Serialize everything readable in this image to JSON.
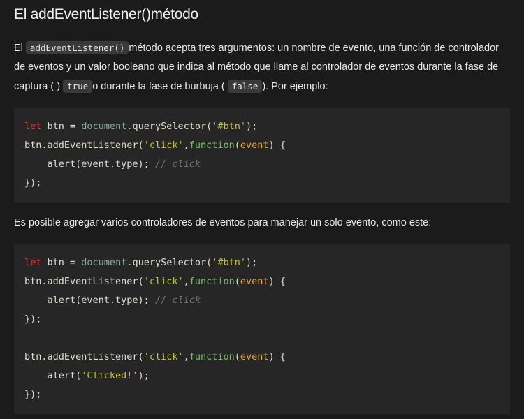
{
  "title": "El addEventListener()método",
  "para1": {
    "t1": "El ",
    "code1": "addEventListener()",
    "t2": "método acepta tres argumentos: un nombre de evento, una función de controlador de eventos y un valor booleano que indica al método que llame al controlador de eventos durante la fase de captura ( ) ",
    "code2": "true",
    "t3": "o durante la fase de burbuja ( ",
    "code3": "false",
    "t4": "). Por ejemplo:"
  },
  "para2": "Es posible agregar varios controladores de eventos para manejar un solo evento, como este:",
  "code_blocks": [
    [
      [
        [
          "kw",
          "let"
        ],
        [
          "pl",
          " btn = "
        ],
        [
          "obj",
          "document"
        ],
        [
          "pl",
          ".querySelector("
        ],
        [
          "str",
          "'#btn'"
        ],
        [
          "pl",
          ");"
        ]
      ],
      [
        [
          "pl",
          "btn.addEventListener("
        ],
        [
          "str",
          "'click'"
        ],
        [
          "pl",
          ","
        ],
        [
          "fn",
          "function"
        ],
        [
          "pl",
          "("
        ],
        [
          "arg",
          "event"
        ],
        [
          "pl",
          ") {"
        ]
      ],
      [
        [
          "pl",
          "    alert(event.type); "
        ],
        [
          "cm",
          "// click"
        ]
      ],
      [
        [
          "pl",
          "});"
        ]
      ]
    ],
    [
      [
        [
          "kw",
          "let"
        ],
        [
          "pl",
          " btn = "
        ],
        [
          "obj",
          "document"
        ],
        [
          "pl",
          ".querySelector("
        ],
        [
          "str",
          "'#btn'"
        ],
        [
          "pl",
          ");"
        ]
      ],
      [
        [
          "pl",
          "btn.addEventListener("
        ],
        [
          "str",
          "'click'"
        ],
        [
          "pl",
          ","
        ],
        [
          "fn",
          "function"
        ],
        [
          "pl",
          "("
        ],
        [
          "arg",
          "event"
        ],
        [
          "pl",
          ") {"
        ]
      ],
      [
        [
          "pl",
          "    alert(event.type); "
        ],
        [
          "cm",
          "// click"
        ]
      ],
      [
        [
          "pl",
          "});"
        ]
      ],
      [
        [
          "pl",
          " "
        ]
      ],
      [
        [
          "pl",
          "btn.addEventListener("
        ],
        [
          "str",
          "'click'"
        ],
        [
          "pl",
          ","
        ],
        [
          "fn",
          "function"
        ],
        [
          "pl",
          "("
        ],
        [
          "arg",
          "event"
        ],
        [
          "pl",
          ") {"
        ]
      ],
      [
        [
          "pl",
          "    alert("
        ],
        [
          "str",
          "'Clicked!'"
        ],
        [
          "pl",
          ");"
        ]
      ],
      [
        [
          "pl",
          "});"
        ]
      ]
    ]
  ]
}
